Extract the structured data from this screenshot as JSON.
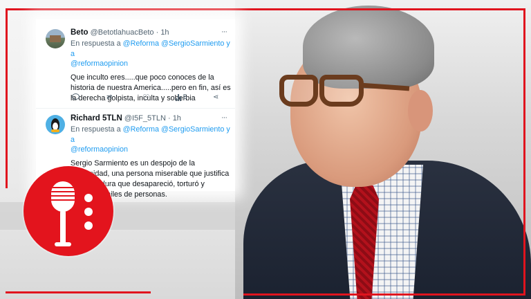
{
  "tweets": [
    {
      "name": "Beto",
      "handle": "@BetotlahuacBeto",
      "time": "· 1h",
      "more": "···",
      "reply_prefix": "En respuesta a",
      "reply_mentions_1": "@Reforma @SergioSarmiento",
      "reply_join": "y a",
      "reply_mentions_2": "@reformaopinion",
      "text": "Que inculto eres.....que poco conoces de la historia de nuestra America.....pero en fin, así es la derecha golpista, inculta y soberbia",
      "views": "5"
    },
    {
      "name": "Richard 5TLN",
      "handle": "@I5F_5TLN",
      "time": "· 1h",
      "more": "···",
      "reply_prefix": "En respuesta a",
      "reply_mentions_1": "@Reforma @SergioSarmiento",
      "reply_join": "y a",
      "reply_mentions_2": "@reformaopinion",
      "text": "Sergio Sarmiento es un despojo de la humanidad, una persona miserable que justifica una dictadura que desapareció, torturó y asesinó a miles de personas."
    }
  ],
  "icons": {
    "reply": "reply-icon",
    "retweet": "retweet-icon",
    "like": "heart-icon",
    "views": "views-icon",
    "share": "share-icon",
    "logo": "microphone-icon"
  },
  "colors": {
    "frame": "#e0141e",
    "logo": "#e3141d",
    "mention": "#1d9bf0"
  }
}
